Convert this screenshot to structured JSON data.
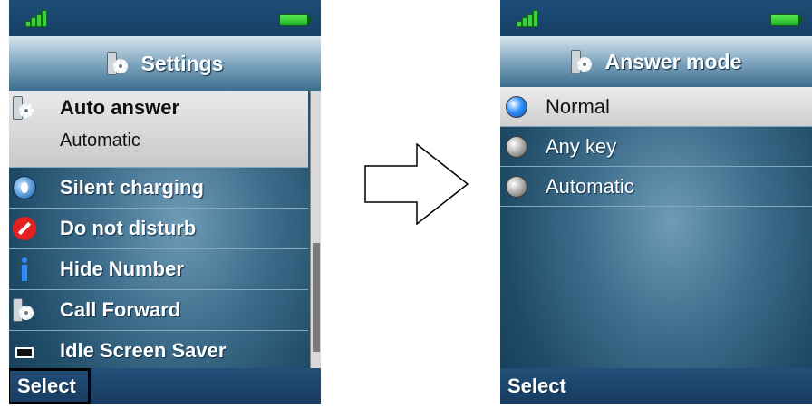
{
  "left_screen": {
    "title": "Settings",
    "menu_items": [
      {
        "label": "Auto answer",
        "subtitle": "Automatic",
        "icon": "settings-icon"
      },
      {
        "label": "Silent charging",
        "icon": "globe-icon"
      },
      {
        "label": "Do not disturb",
        "icon": "do-not-disturb-icon"
      },
      {
        "label": "Hide Number",
        "icon": "info-icon"
      },
      {
        "label": "Call Forward",
        "icon": "settings-icon"
      },
      {
        "label": "Idle Screen Saver",
        "icon": "screen-icon"
      }
    ],
    "soft_key": "Select"
  },
  "right_screen": {
    "title": "Answer mode",
    "options": [
      {
        "label": "Normal",
        "selected": true
      },
      {
        "label": "Any key",
        "selected": false
      },
      {
        "label": "Automatic",
        "selected": false
      }
    ],
    "soft_key": "Select"
  },
  "colors": {
    "selection": "#d9d9d9",
    "status_bar": "#1d4e78",
    "signal": "#39d23a",
    "battery": "#3fd83a",
    "dnd": "#e41f1f",
    "radio_selected": "#2f8fff"
  }
}
